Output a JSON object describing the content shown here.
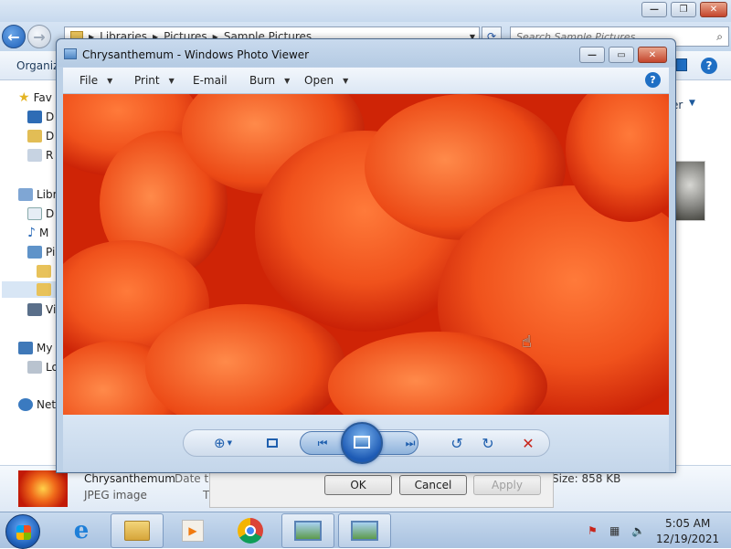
{
  "explorer": {
    "address": {
      "crumbs": [
        "Libraries",
        "Pictures",
        "Sample Pictures"
      ]
    },
    "search_placeholder": "Search Sample Pictures",
    "toolbar": {
      "organize": "Organiz"
    },
    "nav_pane": [
      {
        "label": "Fav",
        "icon": "star-icon"
      },
      {
        "label": "D",
        "icon": "desktop-icon"
      },
      {
        "label": "D",
        "icon": "downloads-icon"
      },
      {
        "label": "R",
        "icon": "recent-places-icon"
      },
      {
        "label": "Libr",
        "icon": "libraries-icon"
      },
      {
        "label": "D",
        "icon": "documents-icon"
      },
      {
        "label": "M",
        "icon": "music-icon"
      },
      {
        "label": "Pi",
        "icon": "pictures-icon"
      },
      {
        "label": "",
        "icon": "folder-icon"
      },
      {
        "label": "",
        "icon": "folder-icon"
      },
      {
        "label": "Vi",
        "icon": "videos-icon"
      },
      {
        "label": "My",
        "icon": "computer-icon"
      },
      {
        "label": "Lo",
        "icon": "local-disk-icon"
      },
      {
        "label": "Net",
        "icon": "network-icon"
      }
    ],
    "right_label": "er",
    "details": {
      "name": "Chrysanthemum",
      "type": "JPEG image",
      "date_label": "Date ta",
      "t_label": "T",
      "size": "Size: 858 KB"
    },
    "dialog": {
      "ok": "OK",
      "cancel": "Cancel",
      "apply": "Apply"
    }
  },
  "photo_viewer": {
    "title": "Chrysanthemum - Windows Photo Viewer",
    "menus": [
      {
        "label": "File",
        "has_caret": true
      },
      {
        "label": "Print",
        "has_caret": true
      },
      {
        "label": "E-mail",
        "has_caret": false
      },
      {
        "label": "Burn",
        "has_caret": true
      },
      {
        "label": "Open",
        "has_caret": true
      }
    ]
  },
  "taskbar": {
    "time": "5:05 AM",
    "date": "12/19/2021"
  }
}
